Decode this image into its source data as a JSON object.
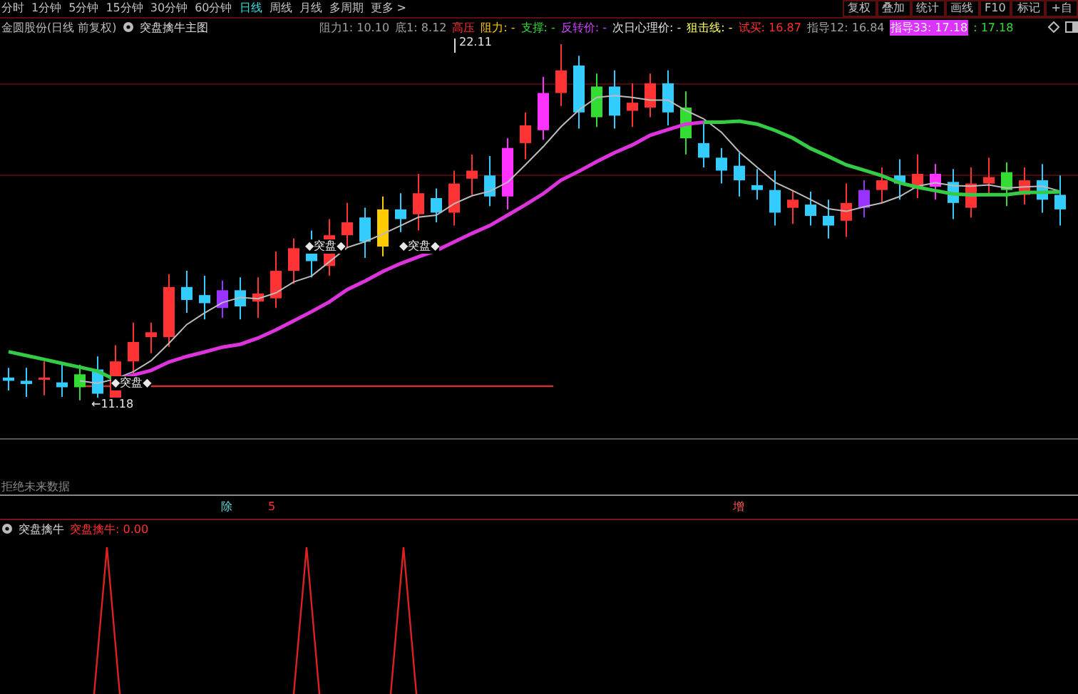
{
  "period_tabs": [
    {
      "label": "分时",
      "selected": false
    },
    {
      "label": "1分钟",
      "selected": false
    },
    {
      "label": "5分钟",
      "selected": false
    },
    {
      "label": "15分钟",
      "selected": false
    },
    {
      "label": "30分钟",
      "selected": false
    },
    {
      "label": "60分钟",
      "selected": false
    },
    {
      "label": "日线",
      "selected": true
    },
    {
      "label": "周线",
      "selected": false
    },
    {
      "label": "月线",
      "selected": false
    },
    {
      "label": "多周期",
      "selected": false
    },
    {
      "label": "更多 >",
      "selected": false
    }
  ],
  "toolbar_buttons": [
    "复权",
    "叠加",
    "统计",
    "画线",
    "F10",
    "标记",
    "+自"
  ],
  "main_legend": {
    "title": "金圆股份(日线 前复权)",
    "indicator": "突盘擒牛主图",
    "items": [
      {
        "text": "阻力1: 10.10",
        "color": "#a0a0a0"
      },
      {
        "text": "底1: 8.12",
        "color": "#a0a0a0"
      },
      {
        "text": "高压",
        "color": "#ff3030"
      },
      {
        "text": "阻力: -",
        "color": "#ffcc00"
      },
      {
        "text": "支撑: -",
        "color": "#33dd33"
      },
      {
        "text": "反转价: -",
        "color": "#cc44ff"
      },
      {
        "text": "次日心理价: -",
        "color": "#e0e0e0"
      },
      {
        "text": "狙击线: -",
        "color": "#ffff66"
      },
      {
        "text": "试买: 16.87",
        "color": "#ff3030"
      },
      {
        "text": "指导12: 16.84",
        "color": "#a0a0a0"
      },
      {
        "text": "指导33: 17.18",
        "color": "#dd33ff"
      },
      {
        "text": ": 17.18",
        "color": "#33dd33"
      }
    ]
  },
  "chart_labels": [
    "22.11",
    "◆突盘◆",
    "◆突盘◆",
    "◆突盘◆",
    "←11.18"
  ],
  "chart_note": "拒绝未来数据",
  "axis_marks": [
    {
      "text": "除",
      "color": "#66dddd"
    },
    {
      "text": "5",
      "color": "#ff3030"
    },
    {
      "text": "增",
      "color": "#ff5555"
    }
  ],
  "sub_legend": {
    "title": "突盘擒牛",
    "value": "突盘擒牛: 0.00"
  }
}
